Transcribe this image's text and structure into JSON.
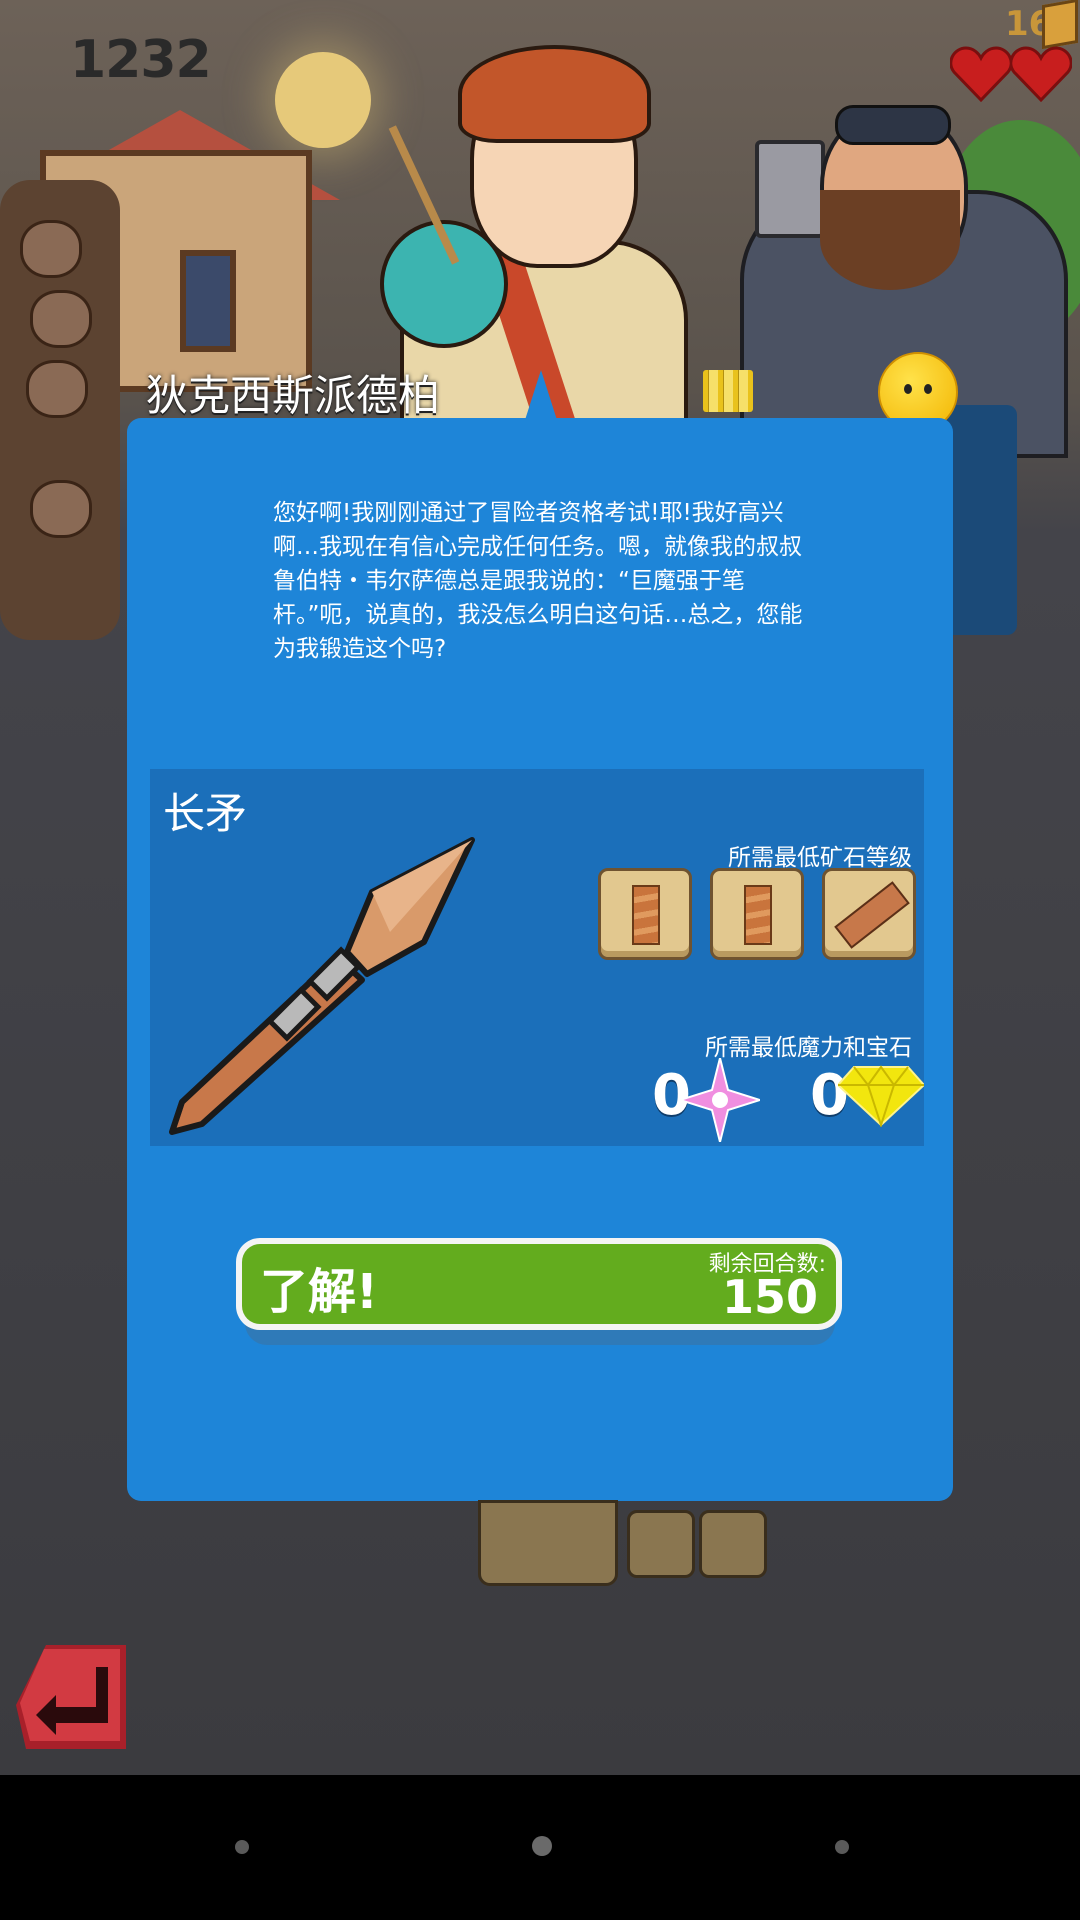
{
  "hud": {
    "score": "1232",
    "coins": "16",
    "hearts": 2
  },
  "character": {
    "name": "狄克西斯派德柏"
  },
  "dialog": {
    "message": "您好啊!我刚刚通过了冒险者资格考试!耶!我好高兴啊…我现在有信心完成任何任务。嗯，就像我的叔叔鲁伯特・韦尔萨德总是跟我说的：“巨魔强于笔杆。”呃，说真的，我没怎么明白这句话…总之，您能为我锻造这个吗?"
  },
  "item": {
    "name": "长矛",
    "ore_label": "所需最低矿石等级",
    "ore_slots": [
      "bar-ore",
      "bar-ore",
      "plank-ore"
    ],
    "magic_label": "所需最低魔力和宝石",
    "magic_value": "0",
    "gem_value": "0"
  },
  "action": {
    "ok_label": "了解!",
    "rounds_label": "剩余回合数:",
    "rounds_value": "150"
  },
  "colors": {
    "dialog_bg": "#1e85d8",
    "item_panel_bg": "#1b6fba",
    "ok_green": "#63ac1e",
    "heart_red": "#c81e1e"
  },
  "icons": [
    "pause-icon",
    "emoji-face-icon",
    "magic-star-icon",
    "diamond-gem-icon",
    "return-arrow-icon",
    "coin-icon",
    "heart-icon"
  ]
}
